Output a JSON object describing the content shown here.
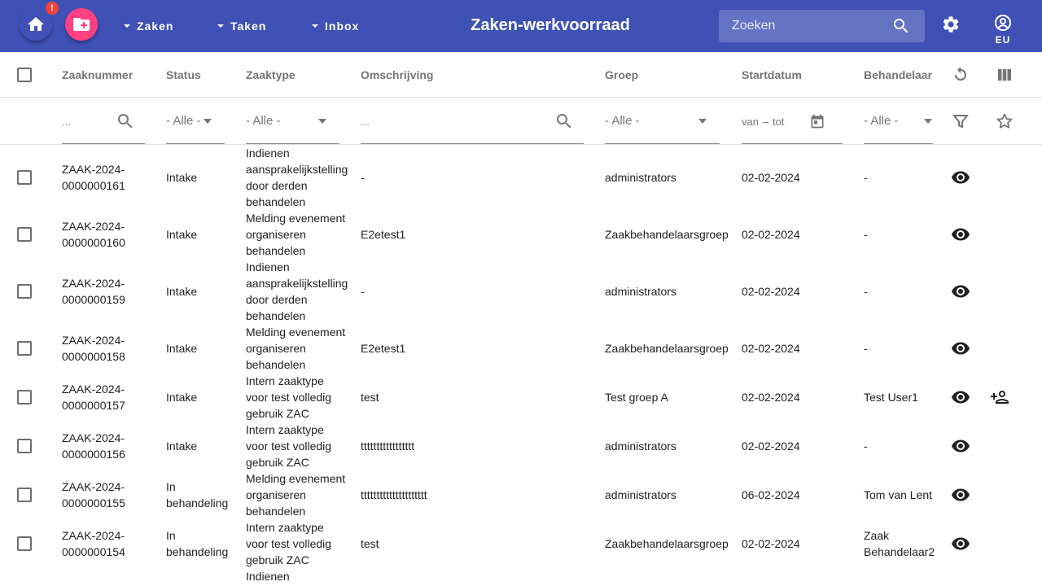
{
  "toolbar": {
    "badge": "!",
    "nav": [
      {
        "label": "Zaken"
      },
      {
        "label": "Taken"
      },
      {
        "label": "Inbox"
      }
    ],
    "title": "Zaken-werkvoorraad",
    "search_placeholder": "Zoeken",
    "user_initials": "EU",
    "colors": {
      "primary": "#3f51b5",
      "accent": "#ff4081",
      "warn": "#f44336"
    }
  },
  "columns": [
    "Zaaknummer",
    "Status",
    "Zaaktype",
    "Omschrijving",
    "Groep",
    "Startdatum",
    "Behandelaar"
  ],
  "filters": {
    "zaaknummer_placeholder": "...",
    "status": "- Alle -",
    "zaaktype": "- Alle -",
    "omschrijving_placeholder": "...",
    "groep": "- Alle -",
    "date_from": "van",
    "date_sep": "–",
    "date_to": "tot",
    "behandelaar": "- Alle -"
  },
  "rows": [
    {
      "zaaknummer": [
        "ZAAK-2024-",
        "0000000161"
      ],
      "status": [
        "Intake"
      ],
      "zaaktype": [
        "Indienen",
        "aansprakelijkstelling",
        "door derden",
        "behandelen"
      ],
      "omschrijving": "-",
      "groep": "administrators",
      "startdatum": "02-02-2024",
      "behandelaar": [
        "-"
      ],
      "assign": false
    },
    {
      "zaaknummer": [
        "ZAAK-2024-",
        "0000000160"
      ],
      "status": [
        "Intake"
      ],
      "zaaktype": [
        "Melding evenement",
        "organiseren",
        "behandelen"
      ],
      "omschrijving": "E2etest1",
      "groep": "Zaakbehandelaarsgroep",
      "startdatum": "02-02-2024",
      "behandelaar": [
        "-"
      ],
      "assign": false
    },
    {
      "zaaknummer": [
        "ZAAK-2024-",
        "0000000159"
      ],
      "status": [
        "Intake"
      ],
      "zaaktype": [
        "Indienen",
        "aansprakelijkstelling",
        "door derden",
        "behandelen"
      ],
      "omschrijving": "-",
      "groep": "administrators",
      "startdatum": "02-02-2024",
      "behandelaar": [
        "-"
      ],
      "assign": false
    },
    {
      "zaaknummer": [
        "ZAAK-2024-",
        "0000000158"
      ],
      "status": [
        "Intake"
      ],
      "zaaktype": [
        "Melding evenement",
        "organiseren",
        "behandelen"
      ],
      "omschrijving": "E2etest1",
      "groep": "Zaakbehandelaarsgroep",
      "startdatum": "02-02-2024",
      "behandelaar": [
        "-"
      ],
      "assign": false
    },
    {
      "zaaknummer": [
        "ZAAK-2024-",
        "0000000157"
      ],
      "status": [
        "Intake"
      ],
      "zaaktype": [
        "Intern zaaktype",
        "voor test volledig",
        "gebruik ZAC"
      ],
      "omschrijving": "test",
      "groep": "Test groep A",
      "startdatum": "02-02-2024",
      "behandelaar": [
        "Test User1"
      ],
      "assign": true
    },
    {
      "zaaknummer": [
        "ZAAK-2024-",
        "0000000156"
      ],
      "status": [
        "Intake"
      ],
      "zaaktype": [
        "Intern zaaktype",
        "voor test volledig",
        "gebruik ZAC"
      ],
      "omschrijving": "ttttttttttttttttt",
      "groep": "administrators",
      "startdatum": "02-02-2024",
      "behandelaar": [
        "-"
      ],
      "assign": false
    },
    {
      "zaaknummer": [
        "ZAAK-2024-",
        "0000000155"
      ],
      "status": [
        "In",
        "behandeling"
      ],
      "zaaktype": [
        "Melding evenement",
        "organiseren",
        "behandelen"
      ],
      "omschrijving": "ttttttttttttttttttttt",
      "groep": "administrators",
      "startdatum": "06-02-2024",
      "behandelaar": [
        "Tom van Lent"
      ],
      "assign": false
    },
    {
      "zaaknummer": [
        "ZAAK-2024-",
        "0000000154"
      ],
      "status": [
        "In",
        "behandeling"
      ],
      "zaaktype": [
        "Intern zaaktype",
        "voor test volledig",
        "gebruik ZAC"
      ],
      "omschrijving": "test",
      "groep": "Zaakbehandelaarsgroep",
      "startdatum": "02-02-2024",
      "behandelaar": [
        "Zaak",
        "Behandelaar2"
      ],
      "assign": false
    },
    {
      "zaaktype": [
        "Indienen"
      ],
      "partial": true
    }
  ]
}
